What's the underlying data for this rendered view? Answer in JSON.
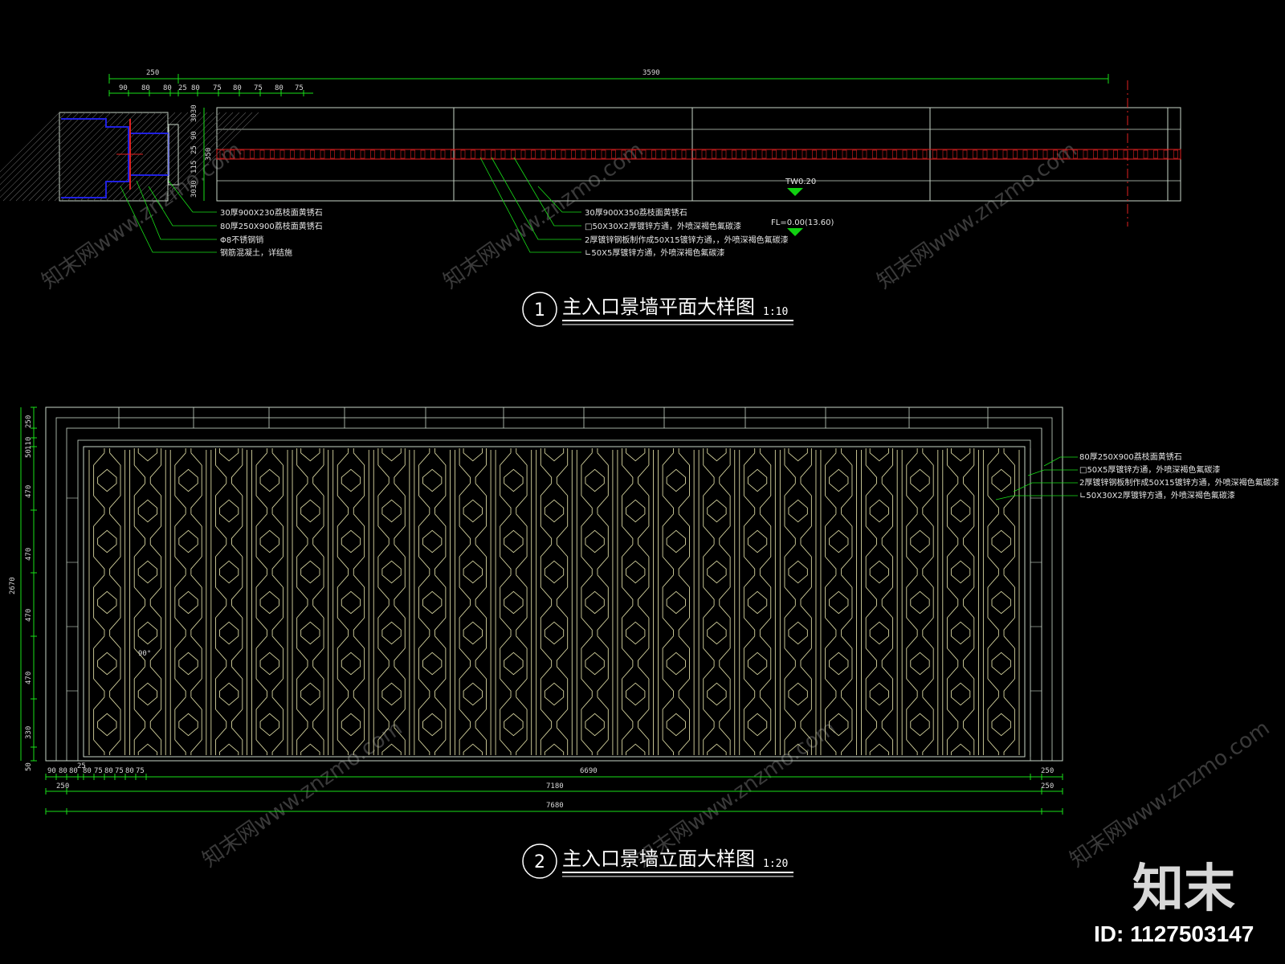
{
  "colors": {
    "background": "#000000",
    "outline": "#c8d6c8",
    "dimension": "#18e018",
    "section_red": "#e02020",
    "section_blue": "#2020e0",
    "lattice": "#d8d6a0",
    "marker": "#10d010"
  },
  "plan": {
    "top_dims": [
      "250",
      "3590"
    ],
    "sub_dims": [
      "90",
      "80",
      "80",
      "25",
      "80",
      "75",
      "80",
      "75",
      "80",
      "75"
    ],
    "side_dims": [
      "3030",
      "90",
      "25",
      "115",
      "3030"
    ],
    "side_total": "350",
    "level_tw": "TW0.20",
    "level_fl": "FL=0.00(13.60)",
    "notes_left": [
      "30厚900X230荔枝面黄锈石",
      "80厚250X900荔枝面黄锈石",
      "Φ8不锈钢销",
      "钢筋混凝土，详结施"
    ],
    "notes_right": [
      "30厚900X350荔枝面黄锈石",
      "□50X30X2厚镀锌方通，外喷深褐色氟碳漆",
      "2厚镀锌钢板制作成50X15镀锌方通，，外喷深褐色氟碳漆",
      "∟50X5厚镀锌方通，外喷深褐色氟碳漆"
    ],
    "title_number": "1",
    "title": "主入口景墙平面大样图",
    "scale": "1:10"
  },
  "elevation": {
    "left_dims": [
      "250",
      "110",
      "50",
      "470",
      "470",
      "470",
      "470",
      "330",
      "50"
    ],
    "left_total": "2670",
    "bottom_sub_dims": [
      "90",
      "80",
      "80",
      "25",
      "80",
      "75",
      "80",
      "75",
      "80",
      "75"
    ],
    "bottom_mid": "6690",
    "bottom_right": "250",
    "row2": [
      "250",
      "7180",
      "250"
    ],
    "overall": "7680",
    "angle": "90°",
    "notes": [
      "80厚250X900荔枝面黄锈石",
      "□50X5厚镀锌方通，外喷深褐色氟碳漆",
      "2厚镀锌钢板制作成50X15镀锌方通，外喷深褐色氟碳漆",
      "∟50X30X2厚镀锌方通，外喷深褐色氟碳漆"
    ],
    "title_number": "2",
    "title": "主入口景墙立面大样图",
    "scale": "1:20"
  },
  "watermark": {
    "site": "znzmo.com",
    "cn": "知末网www.znzmo.com",
    "brand": "知末",
    "id": "ID: 1127503147"
  }
}
